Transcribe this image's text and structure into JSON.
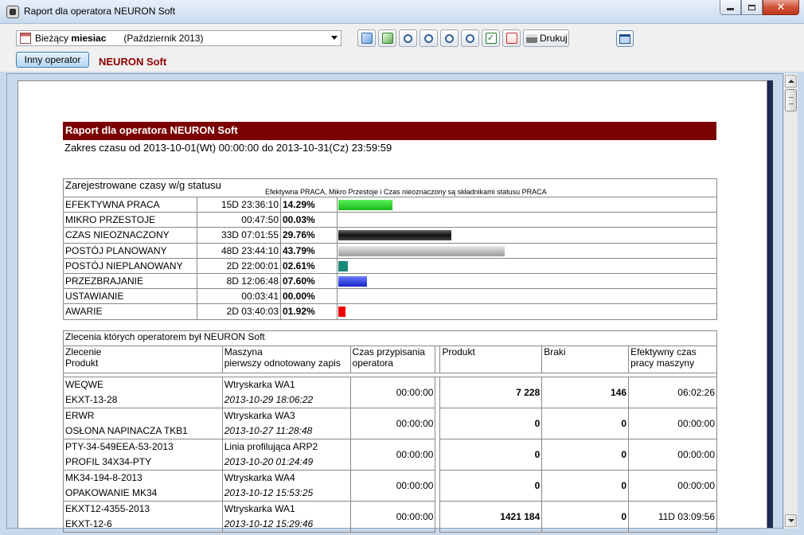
{
  "window": {
    "title": "Raport dla operatora NEURON Soft"
  },
  "toolbar": {
    "period_label_prefix": "Bieżący",
    "period_label_bold": "miesiac",
    "period_value": "(Październik 2013)",
    "print_label": "Drukuj",
    "operator_button": "Inny operator",
    "operator_name": "NEURON Soft"
  },
  "report": {
    "header": "Raport dla operatora NEURON Soft",
    "time_range": "Zakres czasu od 2013-10-01(Wt) 00:00:00 do 2013-10-31(Cz) 23:59:59",
    "status_title": "Zarejestrowane czasy w/g statusu",
    "status_note": "Efektywna PRACA, Mikro Przestoje i Czas nieoznaczony są składnikami statusu PRACA",
    "statuses": [
      {
        "name": "EFEKTYWNA PRACA",
        "duration": "15D 23:36:10",
        "percent": "14.29%",
        "fraction": 0.1429,
        "color": "#22cc22"
      },
      {
        "name": "MIKRO PRZESTOJE",
        "duration": "00:47:50",
        "percent": "00.03%",
        "fraction": 0.0003,
        "color": "#888888"
      },
      {
        "name": "CZAS NIEOZNACZONY",
        "duration": "33D 07:01:55",
        "percent": "29.76%",
        "fraction": 0.2976,
        "color": "#222222"
      },
      {
        "name": "POSTÓJ PLANOWANY",
        "duration": "48D 23:44:10",
        "percent": "43.79%",
        "fraction": 0.4379,
        "color": "#b0b0b0"
      },
      {
        "name": "POSTÓJ NIEPLANOWANY",
        "duration": "2D 22:00:01",
        "percent": "02.61%",
        "fraction": 0.0261,
        "color": "#1a8a7a"
      },
      {
        "name": "PRZEZBRAJANIE",
        "duration": "8D 12:06:48",
        "percent": "07.60%",
        "fraction": 0.076,
        "color": "#2233dd"
      },
      {
        "name": "USTAWIANIE",
        "duration": "00:03:41",
        "percent": "00.00%",
        "fraction": 0.0,
        "color": "#888888"
      },
      {
        "name": "AWARIE",
        "duration": "2D 03:40:03",
        "percent": "01.92%",
        "fraction": 0.0192,
        "color": "#ee0000"
      }
    ],
    "orders_title": "Zlecenia których operatorem był NEURON Soft",
    "orders_headers": {
      "order": "Zlecenie",
      "product": "Produkt",
      "machine": "Maszyna",
      "first_record": "pierwszy odnotowany zapis",
      "assign_time_1": "Czas przypisania",
      "assign_time_2": "operatora",
      "produced": "Produkt",
      "rejects": "Braki",
      "eff_time_1": "Efektywny czas",
      "eff_time_2": "pracy maszyny"
    },
    "orders": [
      {
        "order": "WEQWE",
        "product": "EKXT-13-28",
        "machine": "Wtryskarka WA1",
        "date": "2013-10-29 18:06:22",
        "assign": "00:00:00",
        "produced": "7 228",
        "rejects": "146",
        "eff": "06:02:26"
      },
      {
        "order": "ERWR",
        "product": "OSŁONA NAPINACZA TKB1",
        "machine": "Wtryskarka WA3",
        "date": "2013-10-27 11:28:48",
        "assign": "00:00:00",
        "produced": "0",
        "rejects": "0",
        "eff": "00:00:00"
      },
      {
        "order": "PTY-34-549EEA-53-2013",
        "product": "PROFIL 34X34-PTY",
        "machine": "Linia profilująca ARP2",
        "date": "2013-10-20 01:24:49",
        "assign": "00:00:00",
        "produced": "0",
        "rejects": "0",
        "eff": "00:00:00"
      },
      {
        "order": "MK34-194-8-2013",
        "product": "OPAKOWANIE MK34",
        "machine": "Wtryskarka WA4",
        "date": "2013-10-12 15:53:25",
        "assign": "00:00:00",
        "produced": "0",
        "rejects": "0",
        "eff": "00:00:00"
      },
      {
        "order": "EKXT12-4355-2013",
        "product": "EKXT-12-6",
        "machine": "Wtryskarka WA1",
        "date": "2013-10-12 15:29:46",
        "assign": "00:00:00",
        "produced": "1421 184",
        "rejects": "0",
        "eff": "11D 03:09:56"
      }
    ]
  }
}
